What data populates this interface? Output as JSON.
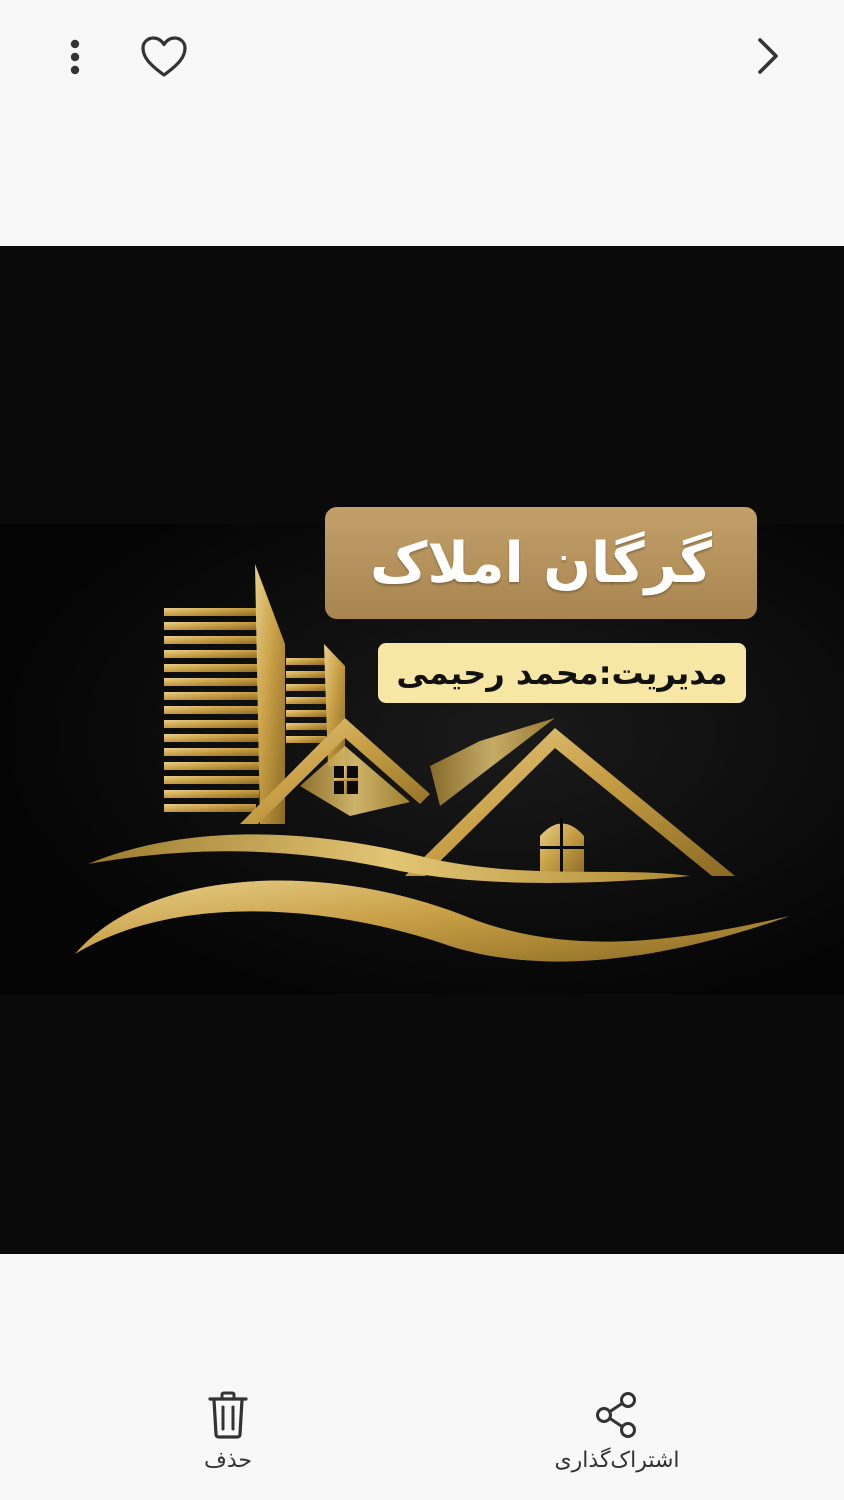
{
  "toolbar": {
    "more_icon": "more-vertical-icon",
    "favorite_icon": "heart-outline-icon",
    "back_icon": "chevron-right-icon"
  },
  "photo": {
    "title": "گرگان املاک",
    "subtitle": "مدیریت:محمد رحیمی",
    "colors": {
      "gold": "#c9a35c",
      "title_box": "#b8945e",
      "subtitle_box": "#f6e8a4",
      "background": "#0a0a0a"
    }
  },
  "actions": {
    "delete": {
      "label": "حذف",
      "icon": "trash-icon"
    },
    "share": {
      "label": "اشتراک‌گذاری",
      "icon": "share-icon"
    }
  }
}
